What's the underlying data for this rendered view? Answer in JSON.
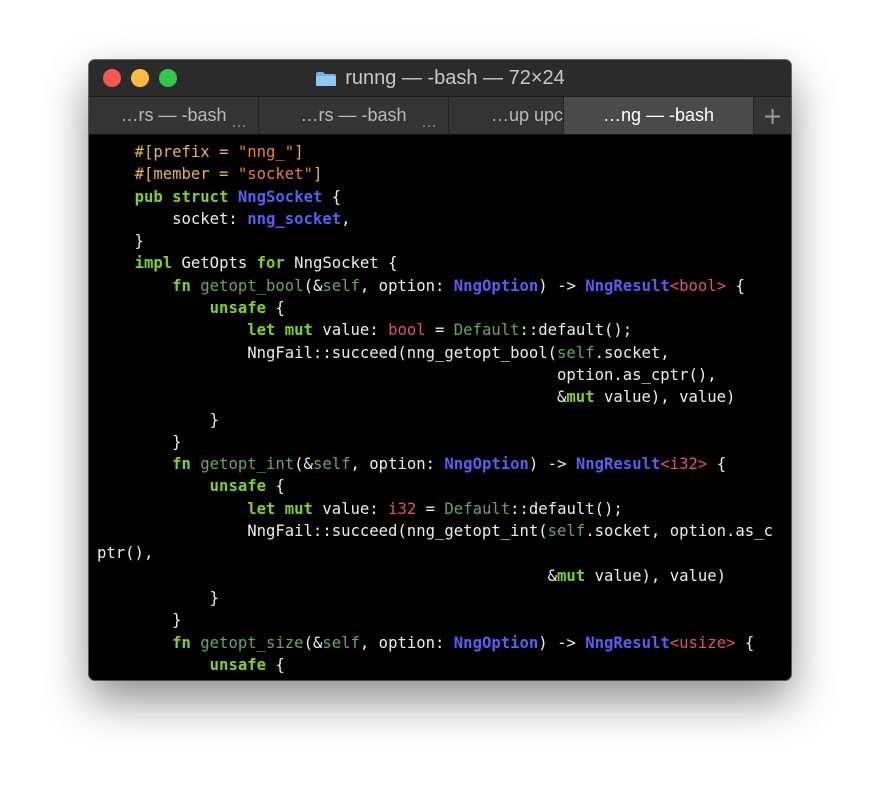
{
  "window": {
    "title": "runng — -bash — 72×24"
  },
  "tabs": [
    {
      "label": "…rs — -bash",
      "active": false,
      "dots": true
    },
    {
      "label": "…rs — -bash",
      "active": false,
      "dots": true
    },
    {
      "label": "…up upc",
      "active": false,
      "dots": false
    },
    {
      "label": "…ng — -bash",
      "active": true,
      "dots": false
    }
  ],
  "tab_add_label": "+",
  "tab_dots": "…",
  "colors": {
    "attr": "#e8b44a",
    "string": "#f07a3e",
    "keyword": "#7ed321",
    "type": "#5a5cf5",
    "function": "#65a85a",
    "primitive": "#e04b88"
  },
  "terminal_lines": [
    [
      [
        "    ",
        ""
      ],
      [
        "#[prefix = ",
        "attr"
      ],
      [
        "\"nng_\"",
        "str"
      ],
      [
        "]",
        "attr"
      ]
    ],
    [
      [
        "    ",
        ""
      ],
      [
        "#[member = ",
        "attr"
      ],
      [
        "\"socket\"",
        "str"
      ],
      [
        "]",
        "attr"
      ]
    ],
    [
      [
        "    ",
        ""
      ],
      [
        "pub",
        "kw"
      ],
      [
        " ",
        ""
      ],
      [
        "struct",
        "kw"
      ],
      [
        " ",
        ""
      ],
      [
        "NngSocket",
        "type"
      ],
      [
        " {",
        ""
      ]
    ],
    [
      [
        "        socket: ",
        ""
      ],
      [
        "nng_socket",
        "type"
      ],
      [
        ",",
        ""
      ]
    ],
    [
      [
        "    }",
        ""
      ]
    ],
    [
      [
        "    ",
        ""
      ],
      [
        "impl",
        "kw"
      ],
      [
        " GetOpts ",
        ""
      ],
      [
        "for",
        "kw"
      ],
      [
        " NngSocket {",
        ""
      ]
    ],
    [
      [
        "        ",
        ""
      ],
      [
        "fn",
        "kw"
      ],
      [
        " ",
        ""
      ],
      [
        "getopt_bool",
        "fn"
      ],
      [
        "(&",
        ""
      ],
      [
        "self",
        "self"
      ],
      [
        ", option: ",
        ""
      ],
      [
        "NngOption",
        "type"
      ],
      [
        ") -> ",
        ""
      ],
      [
        "NngResult",
        "type"
      ],
      [
        "<",
        "prim"
      ],
      [
        "bool",
        "prim"
      ],
      [
        ">",
        "prim"
      ],
      [
        " {",
        ""
      ]
    ],
    [
      [
        "            ",
        ""
      ],
      [
        "unsafe",
        "kw"
      ],
      [
        " {",
        ""
      ]
    ],
    [
      [
        "                ",
        ""
      ],
      [
        "let",
        "kw"
      ],
      [
        " ",
        ""
      ],
      [
        "mut",
        "kw"
      ],
      [
        " value: ",
        ""
      ],
      [
        "bool",
        "prim"
      ],
      [
        " = ",
        ""
      ],
      [
        "Default",
        "def"
      ],
      [
        "::default();",
        ""
      ]
    ],
    [
      [
        "                NngFail::succeed(nng_getopt_bool(",
        ""
      ],
      [
        "self",
        "self"
      ],
      [
        ".socket,",
        ""
      ]
    ],
    [
      [
        "                                                 option.as_cptr(),",
        ""
      ]
    ],
    [
      [
        "                                                 &",
        ""
      ],
      [
        "mut",
        "kw"
      ],
      [
        " value), value)",
        ""
      ]
    ],
    [
      [
        "            }",
        ""
      ]
    ],
    [
      [
        "        }",
        ""
      ]
    ],
    [
      [
        "        ",
        ""
      ],
      [
        "fn",
        "kw"
      ],
      [
        " ",
        ""
      ],
      [
        "getopt_int",
        "fn"
      ],
      [
        "(&",
        ""
      ],
      [
        "self",
        "self"
      ],
      [
        ", option: ",
        ""
      ],
      [
        "NngOption",
        "type"
      ],
      [
        ") -> ",
        ""
      ],
      [
        "NngResult",
        "type"
      ],
      [
        "<",
        "prim"
      ],
      [
        "i32",
        "prim"
      ],
      [
        ">",
        "prim"
      ],
      [
        " {",
        ""
      ]
    ],
    [
      [
        "            ",
        ""
      ],
      [
        "unsafe",
        "kw"
      ],
      [
        " {",
        ""
      ]
    ],
    [
      [
        "                ",
        ""
      ],
      [
        "let",
        "kw"
      ],
      [
        " ",
        ""
      ],
      [
        "mut",
        "kw"
      ],
      [
        " value: ",
        ""
      ],
      [
        "i32",
        "prim"
      ],
      [
        " = ",
        ""
      ],
      [
        "Default",
        "def"
      ],
      [
        "::default();",
        ""
      ]
    ],
    [
      [
        "                NngFail::succeed(nng_getopt_int(",
        ""
      ],
      [
        "self",
        "self"
      ],
      [
        ".socket, option.as_c",
        ""
      ]
    ],
    [
      [
        "ptr(),",
        ""
      ]
    ],
    [
      [
        "                                                &",
        ""
      ],
      [
        "mut",
        "kw"
      ],
      [
        " value), value)",
        ""
      ]
    ],
    [
      [
        "            }",
        ""
      ]
    ],
    [
      [
        "        }",
        ""
      ]
    ],
    [
      [
        "        ",
        ""
      ],
      [
        "fn",
        "kw"
      ],
      [
        " ",
        ""
      ],
      [
        "getopt_size",
        "fn"
      ],
      [
        "(&",
        ""
      ],
      [
        "self",
        "self"
      ],
      [
        ", option: ",
        ""
      ],
      [
        "NngOption",
        "type"
      ],
      [
        ") -> ",
        ""
      ],
      [
        "NngResult",
        "type"
      ],
      [
        "<",
        "prim"
      ],
      [
        "usize",
        "prim"
      ],
      [
        ">",
        "prim"
      ],
      [
        " {",
        ""
      ]
    ],
    [
      [
        "            ",
        ""
      ],
      [
        "unsafe",
        "kw"
      ],
      [
        " {",
        ""
      ]
    ]
  ]
}
